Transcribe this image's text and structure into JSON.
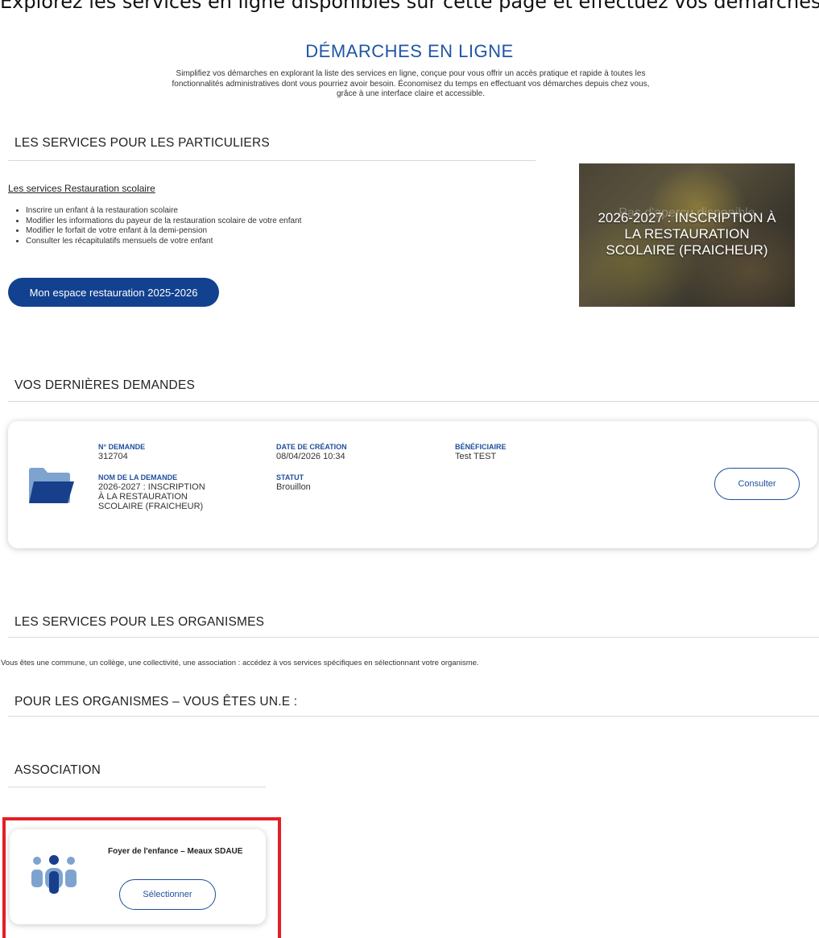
{
  "top_strip_text": "Explorez les services en ligne disponibles sur cette page et effectuez vos démarches en ligne",
  "main": {
    "title": "DÉMARCHES EN LIGNE",
    "intro": "Simplifiez vos démarches en explorant la liste des services en ligne, conçue pour vous offrir un accès pratique et rapide à toutes les fonctionnalités administratives dont vous pourriez avoir besoin. Économisez du temps en effectuant vos démarches depuis chez vous, grâce à une interface claire et accessible."
  },
  "particuliers": {
    "heading": "LES SERVICES POUR LES PARTICULIERS",
    "link": "Les services Restauration scolaire",
    "items": [
      "Inscrire un enfant à la restauration scolaire",
      "Modifier les informations du payeur de la restauration scolaire de votre enfant",
      "Modifier le forfait de votre enfant à la demi-pension",
      "Consulter les récapitulatifs mensuels de votre enfant"
    ],
    "button": "Mon espace restauration 2025-2026",
    "promo": {
      "overlay_text": "Pas d'aperçu disponible",
      "title": "2026-2027 : INSCRIPTION À LA RESTAURATION SCOLAIRE (FRAICHEUR)"
    }
  },
  "demandes": {
    "heading": "VOS DERNIÈRES DEMANDES",
    "card": {
      "numero_label": "N° DEMANDE",
      "numero": "312704",
      "nom_label": "NOM DE LA DEMANDE",
      "nom": "2026-2027 : INSCRIPTION À LA RESTAURATION SCOLAIRE (FRAICHEUR)",
      "date_label": "DATE DE CRÉATION",
      "date": "08/04/2026 10:34",
      "statut_label": "STATUT",
      "statut": "Brouillon",
      "beneficiaire_label": "BÉNÉFICIAIRE",
      "beneficiaire": "Test TEST",
      "button": "Consulter"
    }
  },
  "organismes": {
    "heading": "LES SERVICES POUR LES ORGANISMES",
    "text": "Vous êtes une commune, un collège, une collectivité, une association : accédez à vos services spécifiques en sélectionnant votre organisme.",
    "subheading": "POUR LES ORGANISMES – VOUS ÊTES UN.E :",
    "category": "ASSOCIATION",
    "org_card": {
      "name": "Foyer de l'enfance – Meaux SDAUE",
      "button": "Sélectionner"
    }
  },
  "colors": {
    "accent": "#1f56a4",
    "button_primary": "#12418f",
    "highlight": "#e41e26",
    "icon_blue": "#7ea3cf"
  },
  "icons": [
    "folder-icon",
    "people-icon"
  ]
}
